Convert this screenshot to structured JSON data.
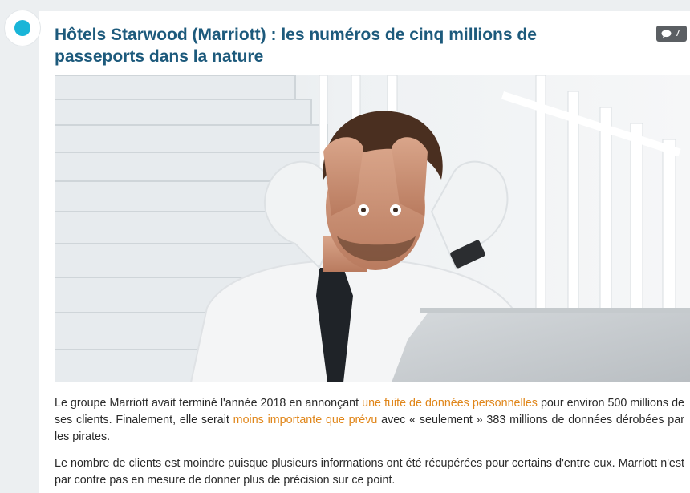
{
  "article": {
    "title": "Hôtels Starwood (Marriott) : les numéros de cinq millions de passeports dans la nature",
    "comment_count": "7",
    "paragraph1": {
      "text_a": "Le groupe Marriott avait terminé l'année 2018 en annonçant ",
      "link1": "une fuite de données personnelles",
      "text_b": " pour environ 500 millions de ses clients. Finalement, elle serait ",
      "link2": "moins importante que prévu",
      "text_c": " avec « seulement » 383 millions de données dérobées par les pirates."
    },
    "paragraph2": "Le nombre de clients est moindre puisque plusieurs informations ont été récupérées pour certains d'entre eux. Marriott n'est par contre pas en mesure de donner plus de précision sur ce point."
  },
  "colors": {
    "accent_dot": "#19b5d8",
    "title": "#1d5a7c",
    "link": "#e0861a",
    "badge": "#5b5f63"
  },
  "icons": {
    "timeline_marker": "circle-dot-icon",
    "comments": "speech-bubble-icon"
  },
  "hero_image": {
    "subject": "stressed man in white shirt and tie holding his head over a laptop on white stairs"
  }
}
